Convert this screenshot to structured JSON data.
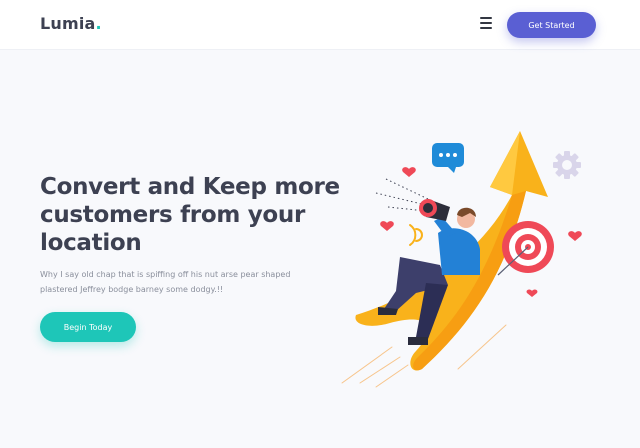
{
  "header": {
    "logo_text": "Lumia",
    "logo_dot": ".",
    "menu_icon": "hamburger-menu-icon",
    "cta_label": "Get Started"
  },
  "hero": {
    "title": "Convert and Keep more customers from your location",
    "description": "Why I say old chap that is spiffing off his nut arse pear shaped plastered Jeffrey bodge barney some dodgy.!!",
    "cta_label": "Begin Today"
  },
  "illustration": {
    "subject": "man-with-megaphone-on-rising-arrow",
    "icons": [
      "chat-bubble-icon",
      "heart-icon",
      "gear-icon",
      "target-icon",
      "megaphone-icon"
    ]
  },
  "colors": {
    "brand_purple": "#5a5fd3",
    "accent_teal": "#1ec6b8",
    "heading": "#3d4152",
    "body_text": "#8a8f9c",
    "arrow_orange": "#f9b21b",
    "heart_red": "#ef4957"
  }
}
